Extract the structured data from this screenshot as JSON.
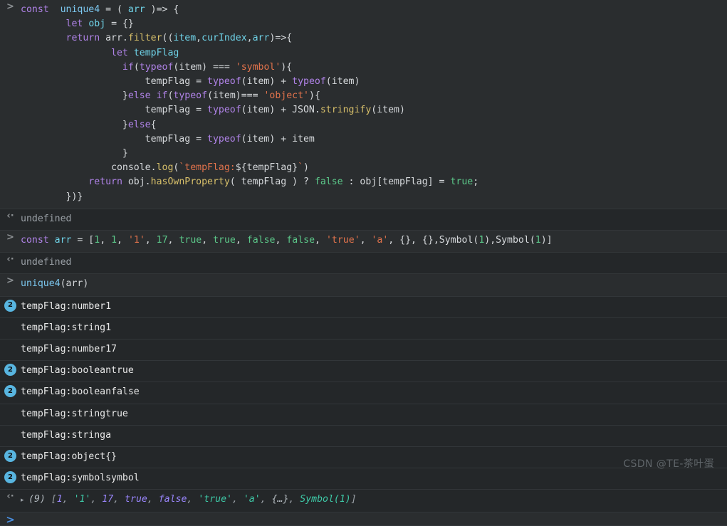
{
  "console": {
    "prompt_symbol": ">",
    "return_symbol": "‹·",
    "disclosure_symbol": "▸",
    "accent_badge_color": "#58b5e0",
    "background_color": "#242729",
    "entries": [
      {
        "kind": "input",
        "marker": ">",
        "code_lines": [
          "const  unique4 = ( arr )=> {",
          "        let obj = {}",
          "        return arr.filter((item,curIndex,arr)=>{",
          "                let tempFlag",
          "                  if(typeof(item) === 'symbol'){",
          "                      tempFlag = typeof(item) + typeof(item)",
          "                  }else if(typeof(item)=== 'object'){",
          "                      tempFlag = typeof(item) + JSON.stringify(item)",
          "                  }else{",
          "                      tempFlag = typeof(item) + item",
          "                  }",
          "                console.log(`tempFlag:${tempFlag}`)",
          "            return obj.hasOwnProperty( tempFlag ) ? false : obj[tempFlag] = true;",
          "        })}"
        ]
      },
      {
        "kind": "result",
        "marker": "‹·",
        "text": "undefined"
      },
      {
        "kind": "input",
        "marker": ">",
        "text": "const arr = [1, 1, '1', 17, true, true, false, false, 'true', 'a', {}, {},Symbol(1),Symbol(1)]"
      },
      {
        "kind": "result",
        "marker": "‹·",
        "text": "undefined"
      },
      {
        "kind": "input",
        "marker": ">",
        "text": "unique4(arr)"
      },
      {
        "kind": "log",
        "badge": "2",
        "text": "tempFlag:number1"
      },
      {
        "kind": "log",
        "badge": "",
        "text": "tempFlag:string1"
      },
      {
        "kind": "log",
        "badge": "",
        "text": "tempFlag:number17"
      },
      {
        "kind": "log",
        "badge": "2",
        "text": "tempFlag:booleantrue"
      },
      {
        "kind": "log",
        "badge": "2",
        "text": "tempFlag:booleanfalse"
      },
      {
        "kind": "log",
        "badge": "",
        "text": "tempFlag:stringtrue"
      },
      {
        "kind": "log",
        "badge": "",
        "text": "tempFlag:stringa"
      },
      {
        "kind": "log",
        "badge": "2",
        "text": "tempFlag:object{}"
      },
      {
        "kind": "log",
        "badge": "2",
        "text": "tempFlag:symbolsymbol"
      },
      {
        "kind": "result-array",
        "marker": "‹·",
        "length_label": "(9)",
        "text": "(9) [1, '1', 17, true, false, 'true', 'a', {…}, Symbol(1)]",
        "items": [
          "1",
          "'1'",
          "17",
          "true",
          "false",
          "'true'",
          "'a'",
          "{…}",
          "Symbol(1)"
        ]
      },
      {
        "kind": "input-active",
        "marker": ">",
        "text": ""
      }
    ]
  },
  "watermark": "CSDN @TE-茶叶蛋"
}
